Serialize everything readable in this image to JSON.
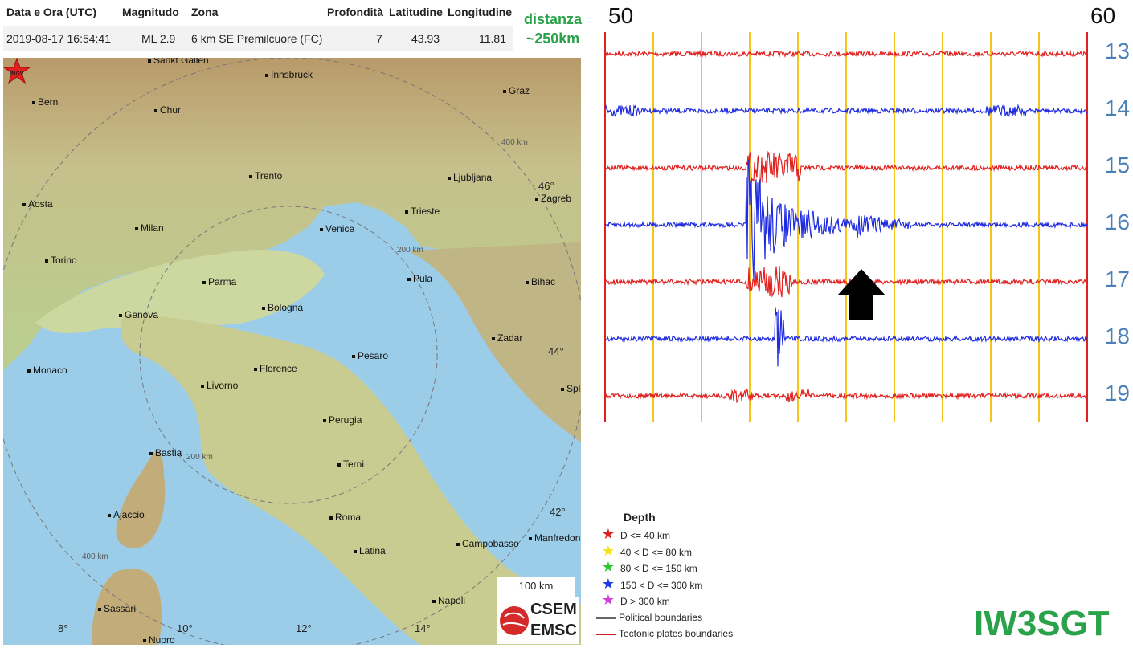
{
  "event_table": {
    "headers": [
      "Data e Ora (UTC)",
      "Magnitudo",
      "Zona",
      "Profondità",
      "Latitudine",
      "Longitudine"
    ],
    "row": [
      "2019-08-17 16:54:41",
      "ML 2.9",
      "6 km SE Premilcuore (FC)",
      "7",
      "43.93",
      "11.81"
    ]
  },
  "distance_label": {
    "line1": "distanza",
    "line2": "~250km"
  },
  "map": {
    "cities": [
      "Sankt Gallen",
      "Innsbruck",
      "Bern",
      "Chur",
      "Graz",
      "Trento",
      "Ljubljana",
      "Zagreb",
      "Aosta",
      "Milan",
      "Venice",
      "Trieste",
      "Torino",
      "Parma",
      "Pula",
      "Bihac",
      "Genova",
      "Bologna",
      "Pesaro",
      "Zadar",
      "Monaco",
      "Florence",
      "Livorno",
      "Perugia",
      "Bastia",
      "Terni",
      "Ajaccio",
      "Roma",
      "Campobasso",
      "Manfredon",
      "Latina",
      "Sassari",
      "Napoli",
      "Nuoro",
      "Spl"
    ],
    "ring_labels": [
      "400 km",
      "200 km",
      "200 km",
      "400 km"
    ],
    "grid_labels": [
      "46°",
      "44°",
      "42°",
      "8°",
      "10°",
      "12°",
      "14°"
    ],
    "epicenter_label": "INGV",
    "scale_bar": "100 km",
    "logo": {
      "line1": "CSEM",
      "line2": "EMSC"
    }
  },
  "legend": {
    "title": "Depth",
    "items": [
      {
        "label": "D <= 40 km",
        "color": "#e0201e"
      },
      {
        "label": "40 < D <= 80 km",
        "color": "#f2e21a"
      },
      {
        "label": "80 < D <= 150 km",
        "color": "#2ec82e"
      },
      {
        "label": "150 < D <= 300 km",
        "color": "#1e3ae0"
      },
      {
        "label": "D > 300 km",
        "color": "#d040d8"
      }
    ],
    "lines": [
      {
        "label": "Political boundaries",
        "color": "#666666"
      },
      {
        "label": "Tectonic plates boundaries",
        "color": "#d02020"
      }
    ]
  },
  "seismogram": {
    "minute_start": "50",
    "minute_end": "60",
    "hours": [
      "13",
      "14",
      "15",
      "16",
      "17",
      "18",
      "19"
    ],
    "trace_colors": [
      "#e0201e",
      "#1e2be0",
      "#e0201e",
      "#1e2be0",
      "#e0201e",
      "#1e2be0",
      "#e0201e"
    ]
  },
  "station": "IW3SGT"
}
